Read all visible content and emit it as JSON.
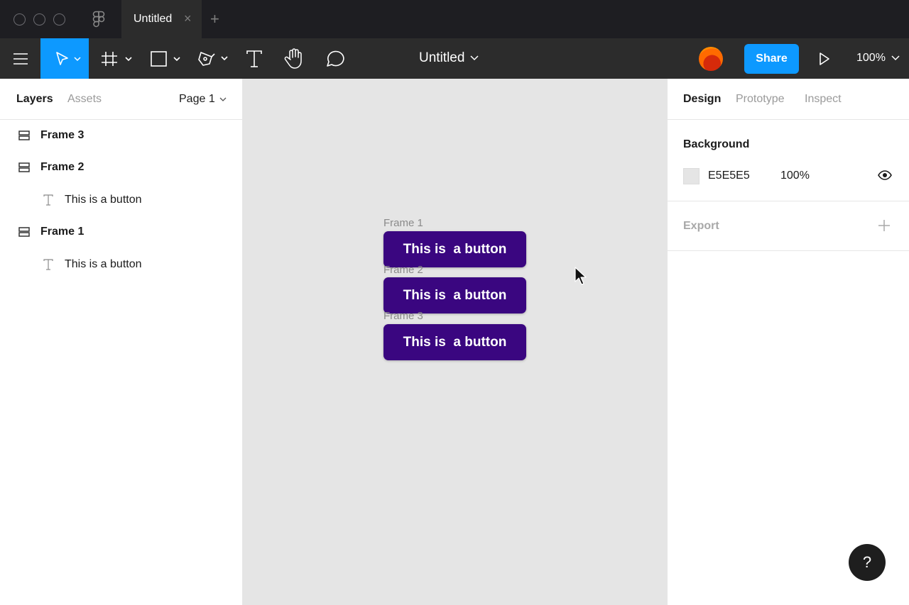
{
  "titlebar": {
    "tab_title": "Untitled",
    "tab_close": "×",
    "tab_add": "+"
  },
  "toolbar": {
    "document_title": "Untitled",
    "share_label": "Share",
    "zoom_label": "100%",
    "active_tool": "move-tool",
    "accent_color": "#0d99ff"
  },
  "left_panel": {
    "tabs": [
      {
        "label": "Layers",
        "active": true
      },
      {
        "label": "Assets",
        "active": false
      }
    ],
    "page_select": "Page 1",
    "layers": [
      {
        "label": "Frame 3",
        "type": "frame"
      },
      {
        "label": "Frame 2",
        "type": "frame"
      },
      {
        "label": "This is a button",
        "type": "text"
      },
      {
        "label": "Frame 1",
        "type": "frame"
      },
      {
        "label": "This is a button",
        "type": "text"
      }
    ]
  },
  "canvas": {
    "background": "#e5e5e5",
    "frames": [
      {
        "label": "Frame 1",
        "button_text": "This is  a button"
      },
      {
        "label": "Frame 2",
        "button_text": "This is  a button"
      },
      {
        "label": "Frame 3",
        "button_text": "This is  a button"
      }
    ],
    "button_color": "#3a0680"
  },
  "right_panel": {
    "tabs": [
      {
        "label": "Design",
        "active": true
      },
      {
        "label": "Prototype",
        "active": false
      },
      {
        "label": "Inspect",
        "active": false
      }
    ],
    "background": {
      "title": "Background",
      "hex": "E5E5E5",
      "opacity": "100%"
    },
    "export_title": "Export",
    "help_label": "?"
  }
}
